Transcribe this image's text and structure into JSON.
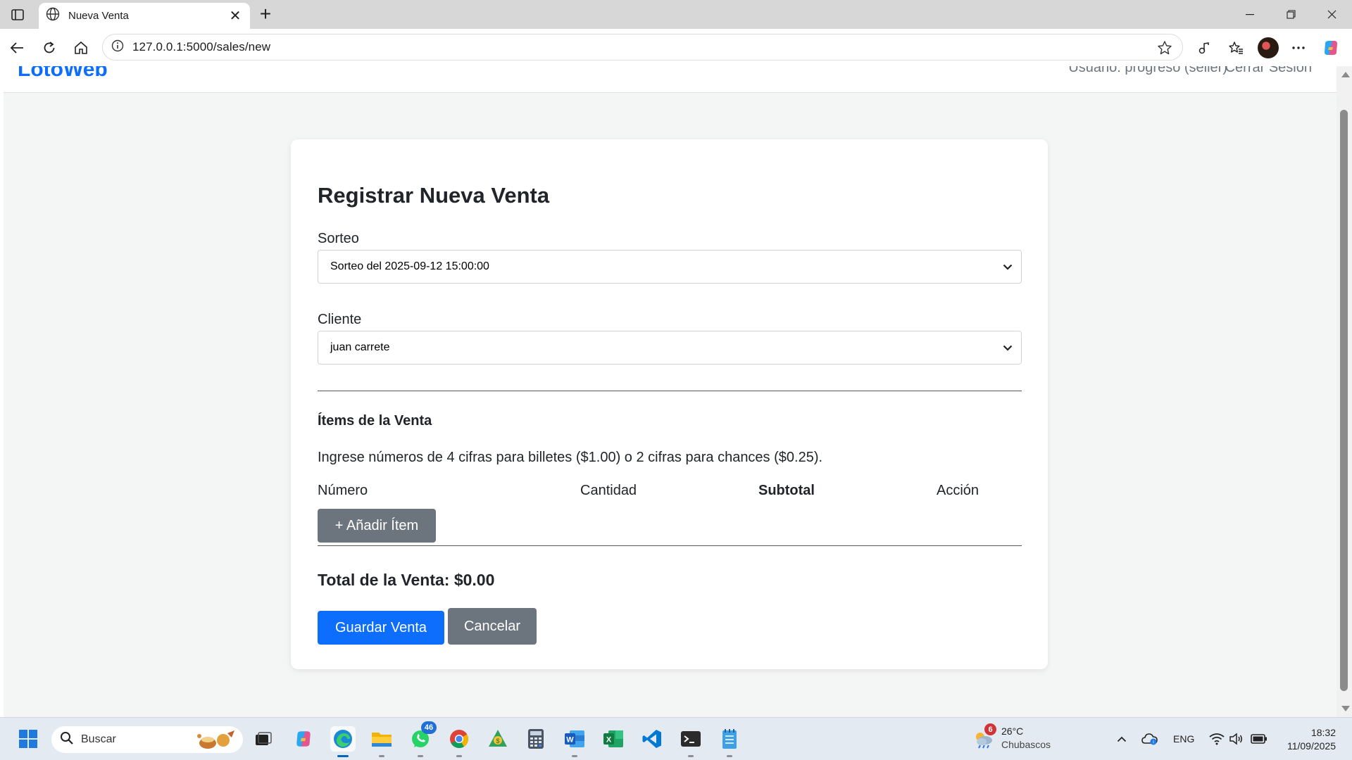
{
  "browser": {
    "tab_title": "Nueva Venta",
    "url": "127.0.0.1:5000/sales/new"
  },
  "navbar": {
    "brand": "LotoWeb",
    "user": "Usuario: progreso (seller)",
    "logout": "Cerrar Sesión"
  },
  "form": {
    "title": "Registrar Nueva Venta",
    "draw_label": "Sorteo",
    "draw_value": "Sorteo del 2025-09-12 15:00:00",
    "client_label": "Cliente",
    "client_value": "juan carrete",
    "items_title": "Ítems de la Venta",
    "help": "Ingrese números de 4 cifras para billetes ($1.00) o 2 cifras para chances ($0.25).",
    "columns": [
      "Número",
      "Cantidad",
      "Subtotal",
      "Acción"
    ],
    "add_item": "+ Añadir Ítem",
    "total": "Total de la Venta: $0.00",
    "save": "Guardar Venta",
    "cancel": "Cancelar"
  },
  "taskbar": {
    "search_placeholder": "Buscar",
    "whatsapp_badge": "46",
    "weather_badge": "6",
    "weather_temp": "26°C",
    "weather_desc": "Chubascos",
    "language": "ENG",
    "time": "18:32",
    "date": "11/09/2025"
  },
  "colors": {
    "primary": "#0d6efd",
    "secondary": "#6c757d",
    "page_bg": "#f4f5f5"
  }
}
